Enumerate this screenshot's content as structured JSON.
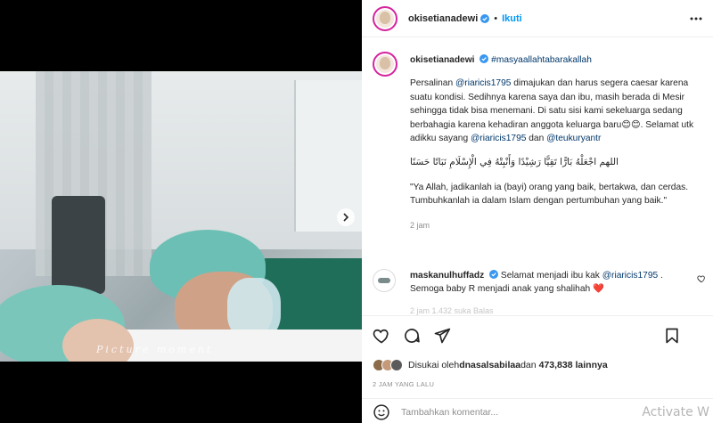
{
  "post": {
    "username": "okisetianadewi",
    "follow_label": "Ikuti",
    "dot": "•"
  },
  "media": {
    "watermark": "Picture moment"
  },
  "caption": {
    "username": "okisetianadewi",
    "hashtag": "#masyaallahtabarakallah",
    "text_1": "Persalinan ",
    "mention_1": "@riaricis1795",
    "text_2": " dimajukan dan harus segera caesar karena suatu kondisi. Sedihnya karena saya dan ibu, masih berada di Mesir sehingga tidak bisa menemani. Di satu sisi kami sekeluarga sedang berbahagia karena kehadiran anggota keluarga baru",
    "emoji": "😊😊",
    "text_3": ". Selamat utk adikku sayang ",
    "mention_2": "@riaricis1795",
    "text_4": " dan ",
    "mention_3": "@teukuryantr",
    "arabic": "اللهم اجْعَلْهُ بَارًّا تَقِيًّا رَشِيْدًا وَأَنْبِتْهُ فِي الْإِسْلَامِ نَبَاتًا حَسَنًا",
    "translation": "\"Ya Allah, jadikanlah ia (bayi) orang yang baik, bertakwa, dan cerdas. Tumbuhkanlah ia dalam Islam dengan pertumbuhan yang baik.\"",
    "time": "2 jam"
  },
  "comment": {
    "username": "maskanulhuffadz",
    "text_1": " Selamat menjadi ibu kak ",
    "mention": "@riaricis1795",
    "text_2": " . Semoga baby R menjadi anak yang shalihah ",
    "heart": "❤️",
    "faded_meta": "2 jam   1.432 suka   Balas"
  },
  "likes": {
    "prefix": "Disukai oleh ",
    "user": "dnasalsabilaa",
    "middle": " dan ",
    "count": "473,838 lainnya"
  },
  "posted_ago": "2 JAM YANG LALU",
  "add_comment_placeholder": "Tambahkan komentar...",
  "watermark_os": "Activate W",
  "colors": {
    "accent": "#0095f6",
    "verified": "#3897f0",
    "mention": "#00376b",
    "heart": "#ed4956",
    "mini_avatar_1": "#8b6b4a",
    "mini_avatar_2": "#c49a7a",
    "mini_avatar_3": "#5a5a5a"
  }
}
